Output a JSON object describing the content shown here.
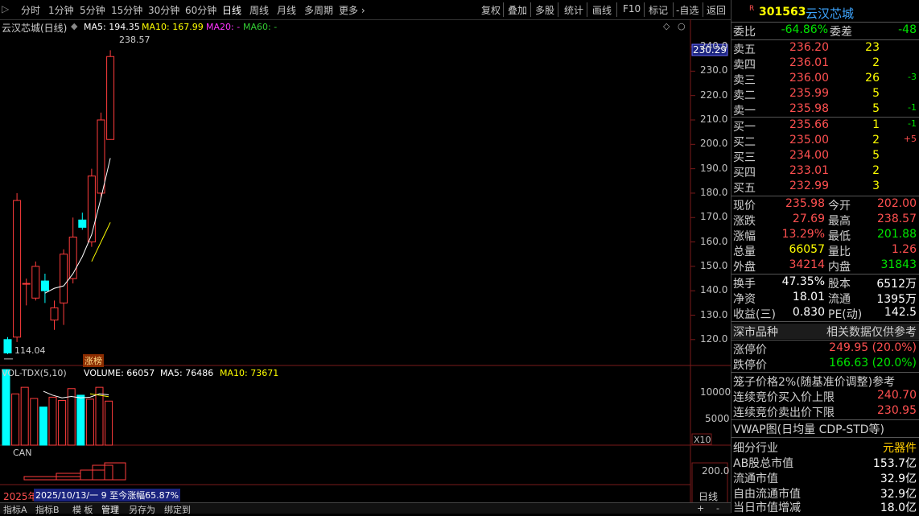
{
  "toolbar": {
    "periods": [
      "分时",
      "1分钟",
      "5分钟",
      "15分钟",
      "30分钟",
      "60分钟",
      "日线",
      "周线",
      "月线",
      "多周期",
      "更多"
    ],
    "active_period": "日线",
    "tools": [
      "复权",
      "叠加",
      "多股",
      "统计",
      "画线",
      "F10",
      "标记",
      "-自选",
      "返回"
    ]
  },
  "chart": {
    "stock_label": "云汉芯城(日线)",
    "ma5": "MA5: 194.35",
    "ma10": "MA10: 167.99",
    "ma20": "MA20: -",
    "ma60": "MA60: -",
    "high_label": "238.57",
    "low_label": "114.04",
    "limit_badge": "涨榜",
    "current_price_tag": "230.29",
    "y_ticks": [
      "240.0",
      "230.0",
      "220.0",
      "210.0",
      "200.0",
      "190.0",
      "180.0",
      "170.0",
      "160.0",
      "150.0",
      "140.0",
      "130.0",
      "120.0"
    ],
    "volume_legend": "VOL-TDX(5,10)",
    "volume_value": "VOLUME: 66057",
    "vol_ma5": "MA5: 76486",
    "vol_ma10": "MA10: 73671",
    "vol_ticks": [
      "10000",
      "5000"
    ],
    "vol_unit": "X10",
    "can_label": "CAN",
    "can_tick": "200.0",
    "range_year": "2025年",
    "range_text": "2025/10/13/一 9 至今涨幅65.87%",
    "period_badge": "日线",
    "colors": {
      "up": "#ff3c3c",
      "down": "#00ffff",
      "ma5": "#ffffff",
      "ma10": "#ffff00",
      "ma20": "#ff33ff",
      "grid": "#7a1a1a"
    }
  },
  "chart_data": {
    "type": "candlestick",
    "candles": [
      {
        "o": 120,
        "c": 114.5,
        "h": 121,
        "l": 114.04
      },
      {
        "o": 121,
        "c": 177,
        "h": 180,
        "l": 119
      },
      {
        "o": 143,
        "c": 143,
        "h": 145,
        "l": 134
      },
      {
        "o": 137,
        "c": 150,
        "h": 152,
        "l": 136
      },
      {
        "o": 144,
        "c": 140,
        "h": 147,
        "l": 135
      },
      {
        "o": 128,
        "c": 133,
        "h": 136,
        "l": 124
      },
      {
        "o": 135,
        "c": 155,
        "h": 157,
        "l": 126
      },
      {
        "o": 145,
        "c": 162,
        "h": 170,
        "l": 143
      },
      {
        "o": 169,
        "c": 166,
        "h": 172,
        "l": 165
      },
      {
        "o": 160,
        "c": 187,
        "h": 190,
        "l": 158
      },
      {
        "o": 180,
        "c": 210,
        "h": 213,
        "l": 178
      },
      {
        "o": 202,
        "c": 235.98,
        "h": 238.57,
        "l": 201.88
      }
    ],
    "volumes": [
      1150,
      780,
      880,
      710,
      580,
      730,
      680,
      860,
      760,
      700,
      880,
      670
    ],
    "ma5": [
      null,
      null,
      null,
      null,
      139,
      141,
      142,
      147,
      154,
      163,
      178,
      194.35
    ],
    "ma10": [
      null,
      null,
      null,
      null,
      null,
      null,
      null,
      null,
      null,
      152,
      160,
      167.99
    ],
    "ylim": [
      114,
      242
    ]
  },
  "panel": {
    "code": "301563",
    "name": "云汉芯城",
    "weibi_label": "委比",
    "weibi_value": "-64.86%",
    "weicha_label": "委差",
    "weicha_value": "-48",
    "sells": [
      {
        "label": "卖五",
        "price": "236.20",
        "vol": "23",
        "chg": ""
      },
      {
        "label": "卖四",
        "price": "236.01",
        "vol": "2",
        "chg": ""
      },
      {
        "label": "卖三",
        "price": "236.00",
        "vol": "26",
        "chg": "-3"
      },
      {
        "label": "卖二",
        "price": "235.99",
        "vol": "5",
        "chg": ""
      },
      {
        "label": "卖一",
        "price": "235.98",
        "vol": "5",
        "chg": "-1"
      }
    ],
    "buys": [
      {
        "label": "买一",
        "price": "235.66",
        "vol": "1",
        "chg": "-1"
      },
      {
        "label": "买二",
        "price": "235.00",
        "vol": "2",
        "chg": "+5"
      },
      {
        "label": "买三",
        "price": "234.00",
        "vol": "5",
        "chg": ""
      },
      {
        "label": "买四",
        "price": "233.01",
        "vol": "2",
        "chg": ""
      },
      {
        "label": "买五",
        "price": "232.99",
        "vol": "3",
        "chg": ""
      }
    ],
    "quotes": [
      {
        "l1": "现价",
        "v1": "235.98",
        "l2": "今开",
        "v2": "202.00"
      },
      {
        "l1": "涨跌",
        "v1": "27.69",
        "l2": "最高",
        "v2": "238.57"
      },
      {
        "l1": "涨幅",
        "v1": "13.29%",
        "l2": "最低",
        "v2": "201.88"
      },
      {
        "l1": "总量",
        "v1": "66057",
        "l2": "量比",
        "v2": "1.26"
      },
      {
        "l1": "外盘",
        "v1": "34214",
        "l2": "内盘",
        "v2": "31843"
      }
    ],
    "fundamentals": [
      {
        "l1": "换手",
        "v1": "47.35%",
        "l2": "股本",
        "v2": "6512万"
      },
      {
        "l1": "净资",
        "v1": "18.01",
        "l2": "流通",
        "v2": "1395万"
      },
      {
        "l1": "收益(三)",
        "v1": "0.830",
        "l2": "PE(动)",
        "v2": "142.5"
      }
    ],
    "market_label": "深市品种",
    "market_note": "相关数据仅供参考",
    "limit_up_label": "涨停价",
    "limit_up_value": "249.95 (20.0%)",
    "limit_down_label": "跌停价",
    "limit_down_value": "166.63 (20.0%)",
    "cage_label": "笼子价格2%(随基准价调整)参考",
    "bid_upper_label": "连续竞价买入价上限",
    "bid_upper_value": "240.70",
    "ask_lower_label": "连续竞价卖出价下限",
    "ask_lower_value": "230.95",
    "vwap_label": "VWAP图(日均量 CDP-STD等)",
    "industry_label": "细分行业",
    "industry_value": "元器件",
    "ab_cap_label": "AB股总市值",
    "ab_cap_value": "153.7亿",
    "float_cap_label": "流通市值",
    "float_cap_value": "32.9亿",
    "free_cap_label": "自由流通市值",
    "free_cap_value": "32.9亿",
    "day_cap_label": "当日市值增减",
    "day_cap_value": "18.0亿"
  },
  "bottom": {
    "tabs": [
      "指标A",
      "指标B",
      "模 板",
      "管理",
      "另存为",
      "绑定到"
    ],
    "right": [
      "+",
      "-"
    ]
  }
}
